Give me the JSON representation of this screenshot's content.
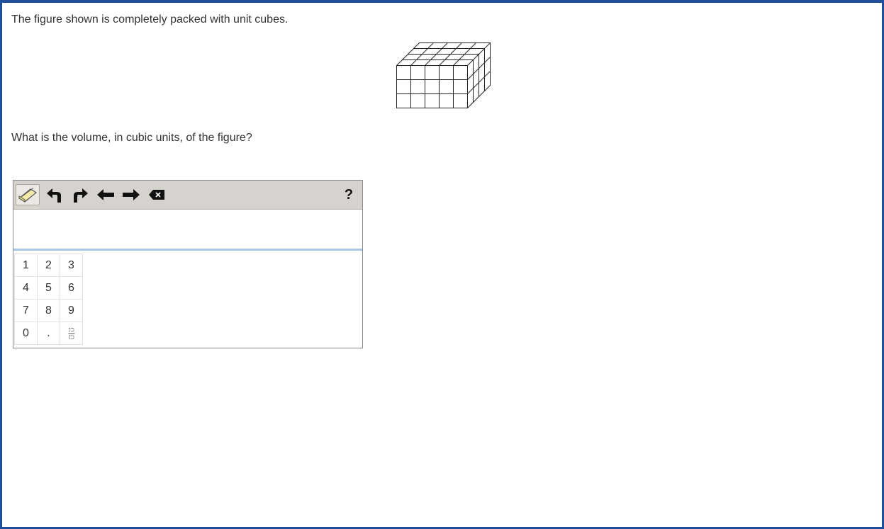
{
  "prompt": "The figure shown is completely packed with unit cubes.",
  "question": "What is the volume, in cubic units, of the figure?",
  "figure": {
    "dimensions": {
      "length": 5,
      "height": 3,
      "depth": 4
    }
  },
  "editor": {
    "toolbar": {
      "tools": [
        "eraser-icon",
        "undo-icon",
        "redo-icon",
        "arrow-left-icon",
        "arrow-right-icon",
        "backspace-icon"
      ],
      "help_label": "?"
    },
    "answer_value": "",
    "keypad": {
      "rows": [
        [
          "1",
          "2",
          "3"
        ],
        [
          "4",
          "5",
          "6"
        ],
        [
          "7",
          "8",
          "9"
        ],
        [
          "0",
          ".",
          ""
        ]
      ],
      "fraction_key_icon": "fraction-icon"
    }
  }
}
